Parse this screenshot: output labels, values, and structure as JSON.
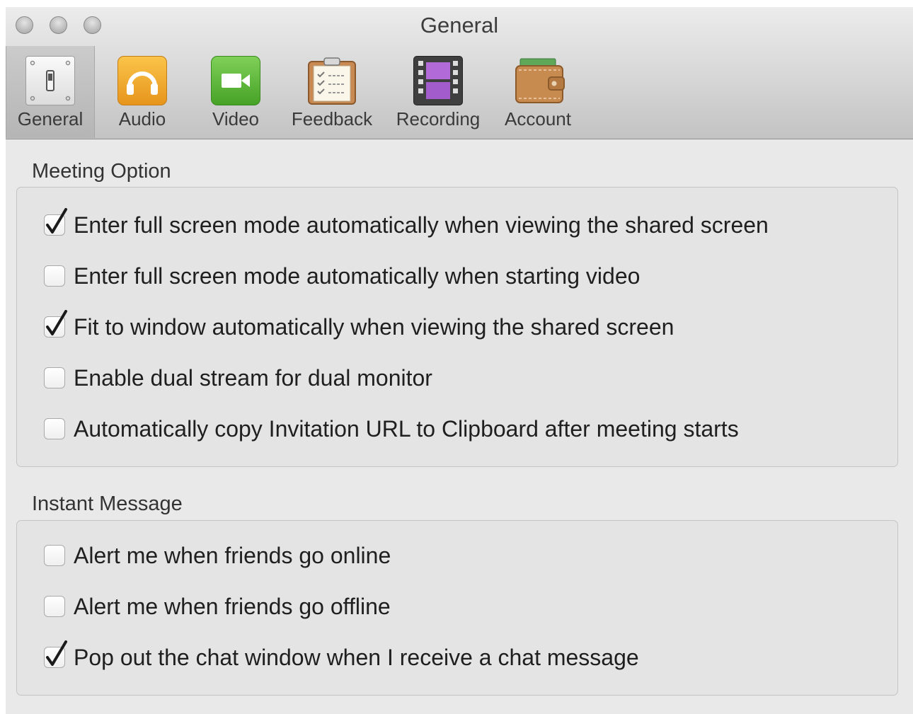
{
  "window": {
    "title": "General",
    "traffic_lights": [
      "close-button",
      "minimize-button",
      "zoom-button"
    ]
  },
  "toolbar": {
    "items": [
      {
        "label": "General",
        "icon": "switch-panel-icon",
        "selected": true
      },
      {
        "label": "Audio",
        "icon": "headphones-icon",
        "selected": false
      },
      {
        "label": "Video",
        "icon": "video-camera-icon",
        "selected": false
      },
      {
        "label": "Feedback",
        "icon": "clipboard-checklist-icon",
        "selected": false
      },
      {
        "label": "Recording",
        "icon": "film-strip-icon",
        "selected": false
      },
      {
        "label": "Account",
        "icon": "wallet-icon",
        "selected": false
      }
    ]
  },
  "meeting_option": {
    "title": "Meeting Option",
    "options": [
      {
        "label": "Enter full screen mode automatically when viewing the shared screen",
        "checked": true
      },
      {
        "label": "Enter full screen mode automatically when starting video",
        "checked": false
      },
      {
        "label": "Fit to window automatically when viewing the shared screen",
        "checked": true
      },
      {
        "label": "Enable dual stream for dual monitor",
        "checked": false
      },
      {
        "label": "Automatically copy Invitation URL to Clipboard after meeting starts",
        "checked": false
      }
    ]
  },
  "instant_message": {
    "title": "Instant Message",
    "options": [
      {
        "label": "Alert me when friends go online",
        "checked": false
      },
      {
        "label": "Alert me when friends go offline",
        "checked": false
      },
      {
        "label": "Pop out the chat window when I receive a chat message",
        "checked": true
      }
    ]
  },
  "colors": {
    "audio_icon": "#f2a92b",
    "video_icon": "#5fb63a",
    "recording_icon": "#9b59c7",
    "account_icon": "#c98a4b"
  }
}
